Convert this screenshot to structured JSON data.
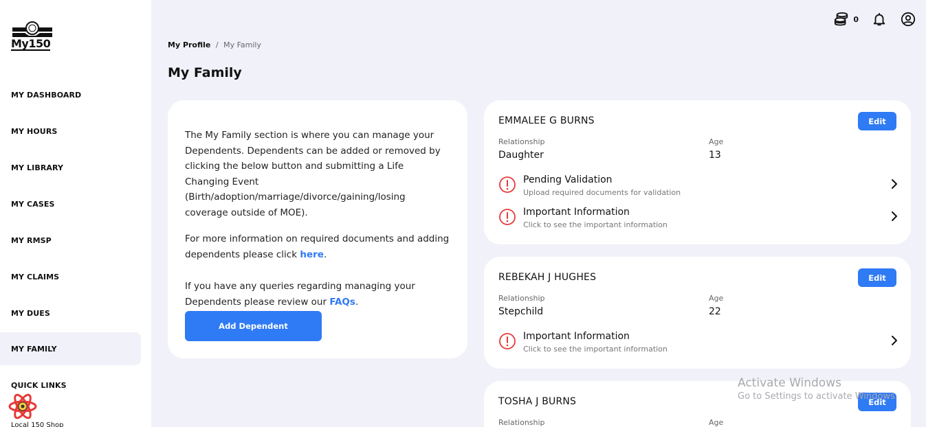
{
  "app": {
    "logo_text": "My150"
  },
  "sidebar": {
    "items": [
      {
        "label": "MY DASHBOARD"
      },
      {
        "label": "MY HOURS"
      },
      {
        "label": "MY LIBRARY"
      },
      {
        "label": "MY CASES"
      },
      {
        "label": "MY RMSP"
      },
      {
        "label": "MY CLAIMS"
      },
      {
        "label": "MY DUES"
      },
      {
        "label": "MY FAMILY",
        "active": true
      },
      {
        "label": "QUICK LINKS"
      }
    ],
    "shop_label": "Local 150 Shop"
  },
  "topbar": {
    "coin_count": "0",
    "icons": [
      "coins-icon",
      "bell-icon",
      "user-circle-icon"
    ]
  },
  "breadcrumb": {
    "root": "My Profile",
    "separator": "/",
    "current": "My Family"
  },
  "page": {
    "title": "My Family"
  },
  "info": {
    "p1": "The My Family section is where you can manage your Dependents. Dependents can be added or removed by clicking the below button and submitting a Life Changing Event (Birth/adoption/marriage/divorce/gaining/losing coverage outside of MOE).",
    "p2_text": "For more information on required documents and adding dependents please click ",
    "p2_link": "here",
    "p2_end": ".",
    "p3_text": "If you have any queries regarding managing your Dependents please review our ",
    "p3_link": "FAQs",
    "p3_end": ".",
    "add_button": "Add Dependent"
  },
  "dependents": [
    {
      "name": "EMMALEE G BURNS",
      "edit_label": "Edit",
      "relationship_label": "Relationship",
      "relationship": "Daughter",
      "age_label": "Age",
      "age": "13",
      "statuses": [
        {
          "title": "Pending Validation",
          "subtitle": "Upload required documents for validation"
        },
        {
          "title": "Important Information",
          "subtitle": "Click to see the important information"
        }
      ]
    },
    {
      "name": "REBEKAH J HUGHES",
      "edit_label": "Edit",
      "relationship_label": "Relationship",
      "relationship": "Stepchild",
      "age_label": "Age",
      "age": "22",
      "statuses": [
        {
          "title": "Important Information",
          "subtitle": "Click to see the important information"
        }
      ]
    },
    {
      "name": "TOSHA J BURNS",
      "edit_label": "Edit",
      "relationship_label": "Relationship",
      "age_label": "Age"
    }
  ],
  "watermark": {
    "line1": "Activate Windows",
    "line2": "Go to Settings to activate Windows."
  },
  "colors": {
    "accent": "#2f7af5",
    "background": "#f1f1fa",
    "alert": "#e53935"
  }
}
